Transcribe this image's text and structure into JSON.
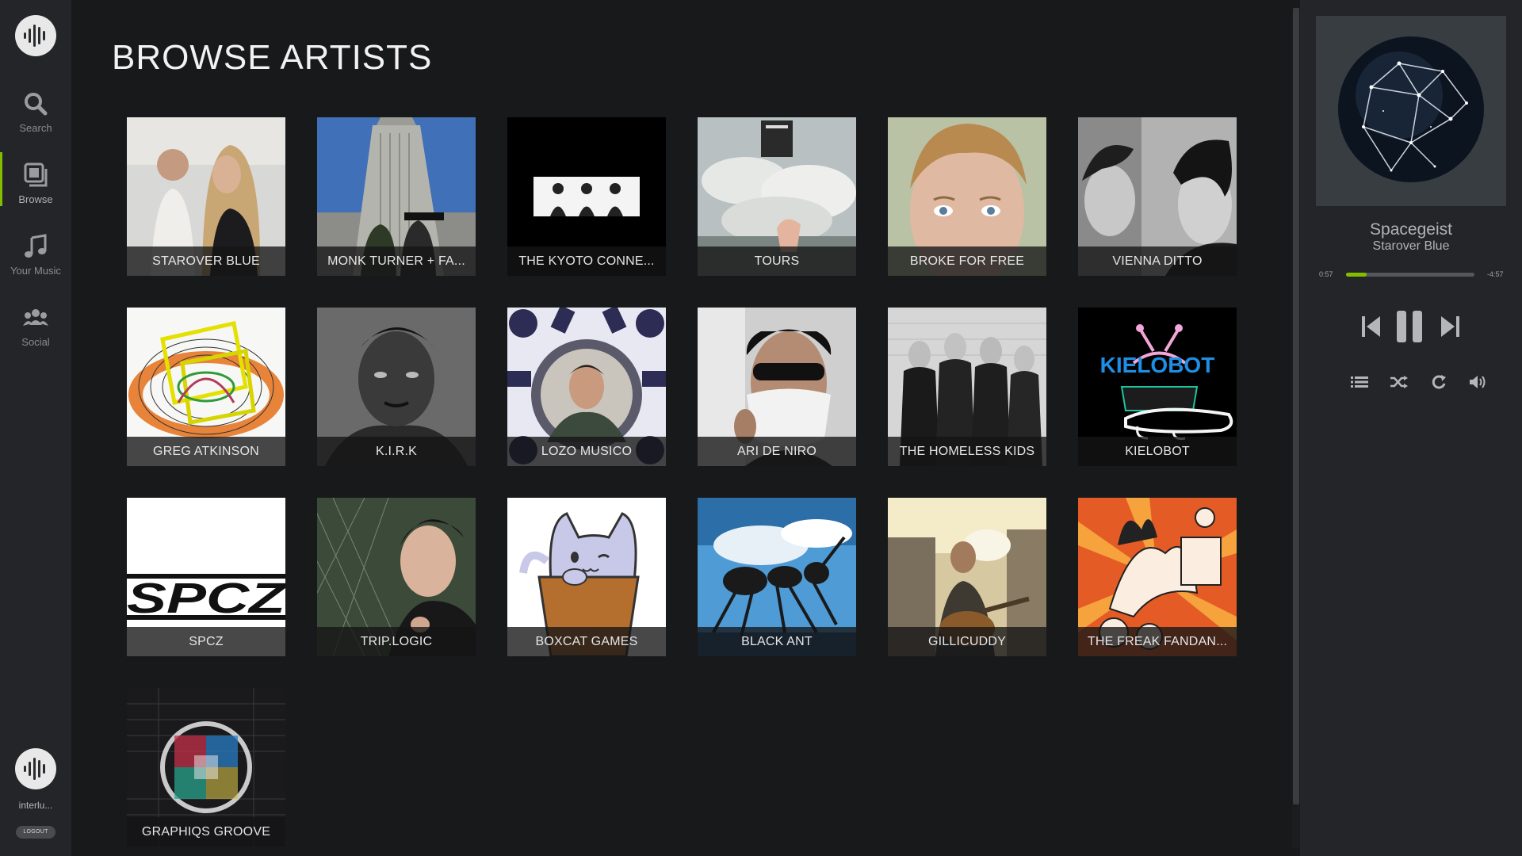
{
  "sidebar": {
    "nav": [
      {
        "label": "Search",
        "icon": "search-icon"
      },
      {
        "label": "Browse",
        "icon": "browse-icon",
        "active": true
      },
      {
        "label": "Your Music",
        "icon": "music-note-icon"
      },
      {
        "label": "Social",
        "icon": "users-icon"
      }
    ],
    "user_name": "interlu...",
    "logout_label": "LOGOUT"
  },
  "main": {
    "title": "BROWSE ARTISTS",
    "artists": [
      {
        "name": "STAROVER BLUE"
      },
      {
        "name": "MONK TURNER + FA..."
      },
      {
        "name": "THE KYOTO CONNE..."
      },
      {
        "name": "TOURS"
      },
      {
        "name": "BROKE FOR FREE"
      },
      {
        "name": "VIENNA DITTO"
      },
      {
        "name": "GREG ATKINSON"
      },
      {
        "name": "K.I.R.K"
      },
      {
        "name": "LOZO MUSICO"
      },
      {
        "name": "ARI DE NIRO"
      },
      {
        "name": "THE HOMELESS KIDS"
      },
      {
        "name": "KIELOBOT"
      },
      {
        "name": "SPCZ"
      },
      {
        "name": "TRIP.LOGIC"
      },
      {
        "name": "BOXCAT GAMES"
      },
      {
        "name": "BLACK ANT"
      },
      {
        "name": "GILLICUDDY"
      },
      {
        "name": "THE FREAK FANDAN..."
      },
      {
        "name": "GRAPHIQS GROOVE"
      }
    ]
  },
  "player": {
    "track_title": "Spacegeist",
    "track_artist": "Starover Blue",
    "elapsed": "0:57",
    "remaining": "-4:57",
    "progress_percent": 16,
    "accent_color": "#84bd00"
  }
}
